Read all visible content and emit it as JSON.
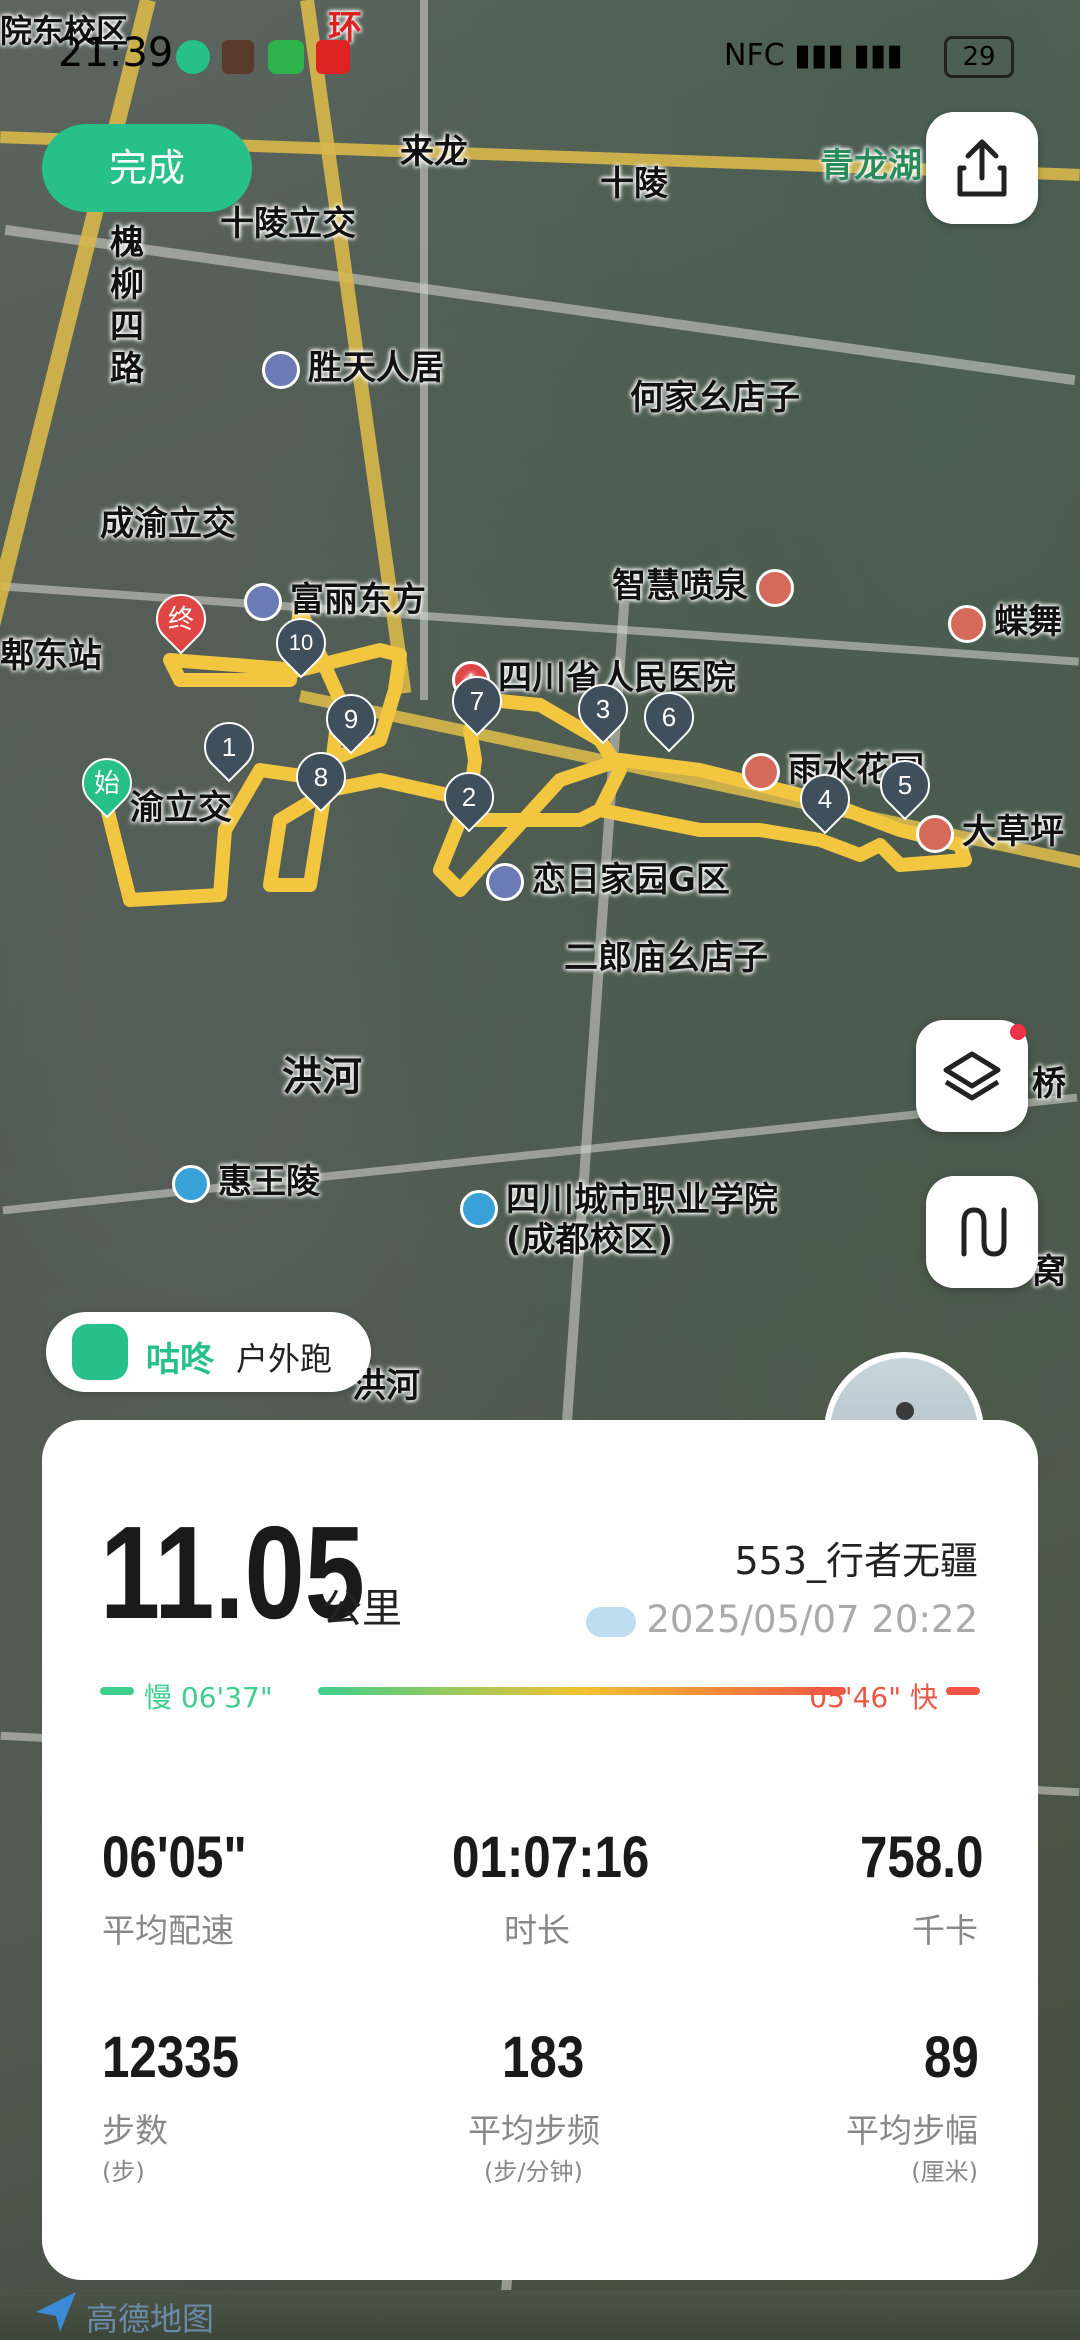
{
  "status_bar": {
    "time": "21:39",
    "battery": "29"
  },
  "header": {
    "done_label": "完成"
  },
  "map": {
    "labels": {
      "campus_top": "院东校区",
      "laolong": "来龙",
      "shiling": "十陵",
      "qinglong": "青龙湖",
      "shiling_interchange": "十陵立交",
      "huailiu_road": "槐柳四路",
      "shengtian": "胜天人居",
      "hejia": "何家幺店子",
      "chengyu_interchange": "成渝立交",
      "zhihui": "智慧喷泉",
      "fuli": "富丽东方",
      "dongzhan": "郫东站",
      "sichuan_hospital": "四川省人民医院",
      "yushui": "雨水花园",
      "dacaoping": "大草坪",
      "yu_interchange": "渝立交",
      "lianri": "恋日家园G区",
      "erlang": "二郎庙幺店子",
      "honghe": "洪河",
      "huiwangling": "惠王陵",
      "vocational": "四川城市职业学院(成都校区)",
      "honghe2": "洪河",
      "dieguan": "蝶舞",
      "qiao": "桥",
      "wo": "窝",
      "huan": "环"
    },
    "start_label": "始",
    "end_label": "终",
    "markers": [
      "1",
      "2",
      "3",
      "4",
      "5",
      "6",
      "7",
      "8",
      "9",
      "10"
    ]
  },
  "brand": {
    "name": "咕咚",
    "mode": "户外跑"
  },
  "summary": {
    "distance": "11.05",
    "distance_unit": "公里",
    "username": "553_行者无疆",
    "datetime": "2025/05/07 20:22",
    "pace_slow": "慢 06'37\"",
    "pace_fast": "05'46\" 快",
    "colors": {
      "slow": "#3ecf8e",
      "fast": "#ee5544",
      "mid": "#f2c230"
    }
  },
  "stats": [
    {
      "value": "06'05\"",
      "label": "平均配速",
      "unit": ""
    },
    {
      "value": "01:07:16",
      "label": "时长",
      "unit": ""
    },
    {
      "value": "758.0",
      "label": "千卡",
      "unit": ""
    },
    {
      "value": "12335",
      "label": "步数",
      "unit": "(步)"
    },
    {
      "value": "183",
      "label": "平均步频",
      "unit": "(步/分钟)"
    },
    {
      "value": "89",
      "label": "平均步幅",
      "unit": "(厘米)"
    }
  ],
  "footer": {
    "map_provider": "高德地图"
  }
}
